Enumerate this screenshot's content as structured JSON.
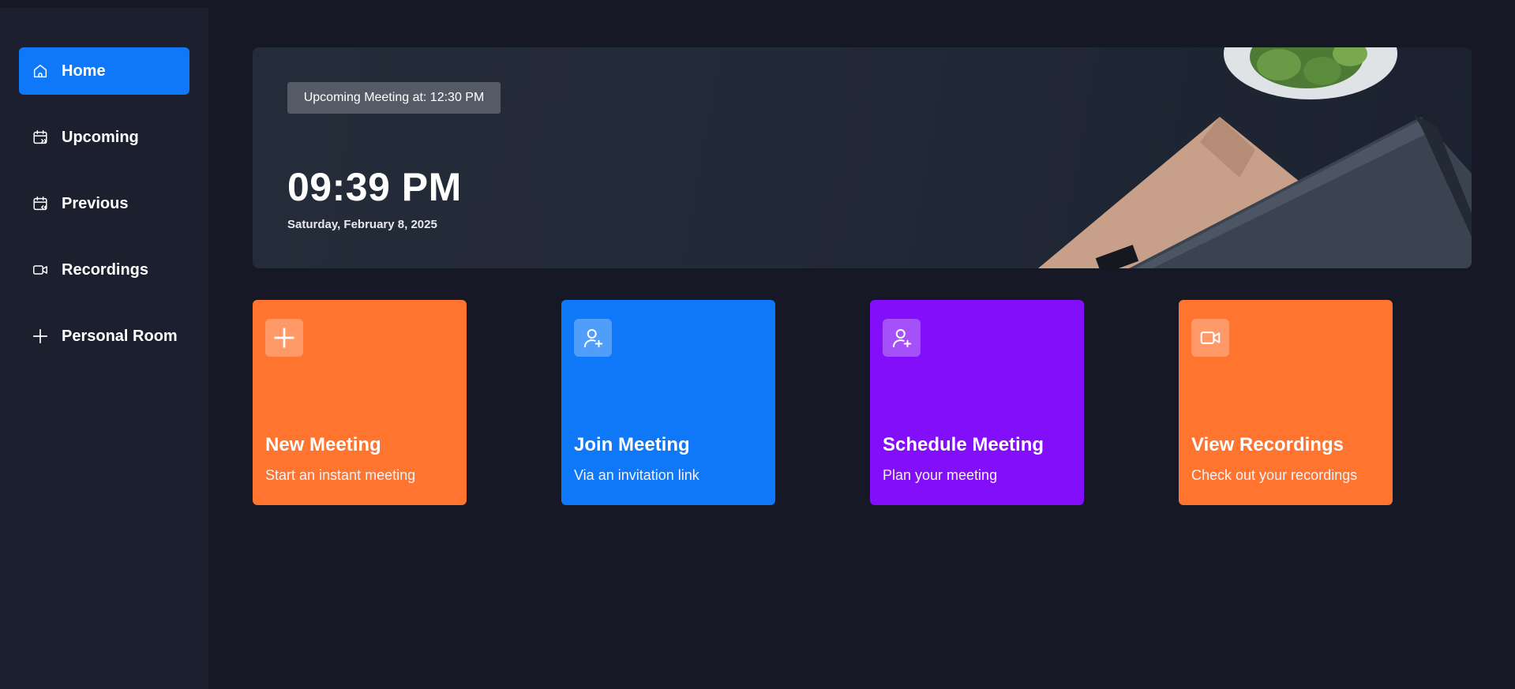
{
  "sidebar": {
    "items": [
      {
        "label": "Home",
        "icon": "home-icon",
        "active": true
      },
      {
        "label": "Upcoming",
        "icon": "calendar-upcoming-icon",
        "active": false
      },
      {
        "label": "Previous",
        "icon": "calendar-previous-icon",
        "active": false
      },
      {
        "label": "Recordings",
        "icon": "video-icon",
        "active": false
      },
      {
        "label": "Personal Room",
        "icon": "plus-icon",
        "active": false
      }
    ]
  },
  "hero": {
    "upcoming_label": "Upcoming Meeting at: 12:30 PM",
    "time": "09:39 PM",
    "date": "Saturday, February 8, 2025"
  },
  "cards": [
    {
      "title": "New Meeting",
      "subtitle": "Start an instant meeting",
      "icon": "plus-icon",
      "color": "#ff742e"
    },
    {
      "title": "Join Meeting",
      "subtitle": "Via an invitation link",
      "icon": "add-user-icon",
      "color": "#0e78f9"
    },
    {
      "title": "Schedule Meeting",
      "subtitle": "Plan your meeting",
      "icon": "add-user-icon",
      "color": "#830ef9"
    },
    {
      "title": "View Recordings",
      "subtitle": "Check out your recordings",
      "icon": "video-icon",
      "color": "#ff742e"
    }
  ],
  "colors": {
    "accent": "#0e78f9",
    "background": "#161925",
    "sidebar": "#1c1f2e"
  }
}
